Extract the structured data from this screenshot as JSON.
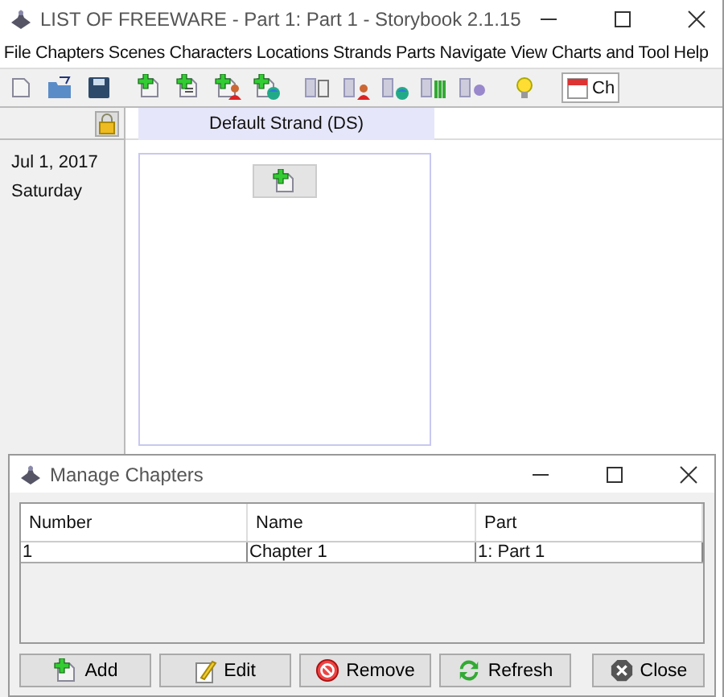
{
  "window": {
    "title": "LIST OF FREEWARE - Part 1: Part 1 - Storybook 2.1.15"
  },
  "menu": [
    "File",
    "Chapters",
    "Scenes",
    "Characters",
    "Locations",
    "Strands",
    "Parts",
    "Navigate",
    "View",
    "Charts and Tool",
    "Help"
  ],
  "toolbar": {
    "combo_value": "Ch"
  },
  "strand": {
    "header": "Default Strand (DS)"
  },
  "date": {
    "date": "Jul 1, 2017",
    "weekday": "Saturday"
  },
  "dialog": {
    "title": "Manage Chapters",
    "table": {
      "columns": [
        "Number",
        "Name",
        "Part"
      ],
      "rows": [
        [
          "1",
          "Chapter 1",
          "1: Part 1"
        ]
      ]
    },
    "buttons": [
      {
        "label": "Add",
        "kind": "add"
      },
      {
        "label": "Edit",
        "kind": "edit"
      },
      {
        "label": "Remove",
        "kind": "remove"
      },
      {
        "label": "Refresh",
        "kind": "refresh"
      },
      {
        "label": "Close",
        "kind": "close"
      }
    ]
  }
}
